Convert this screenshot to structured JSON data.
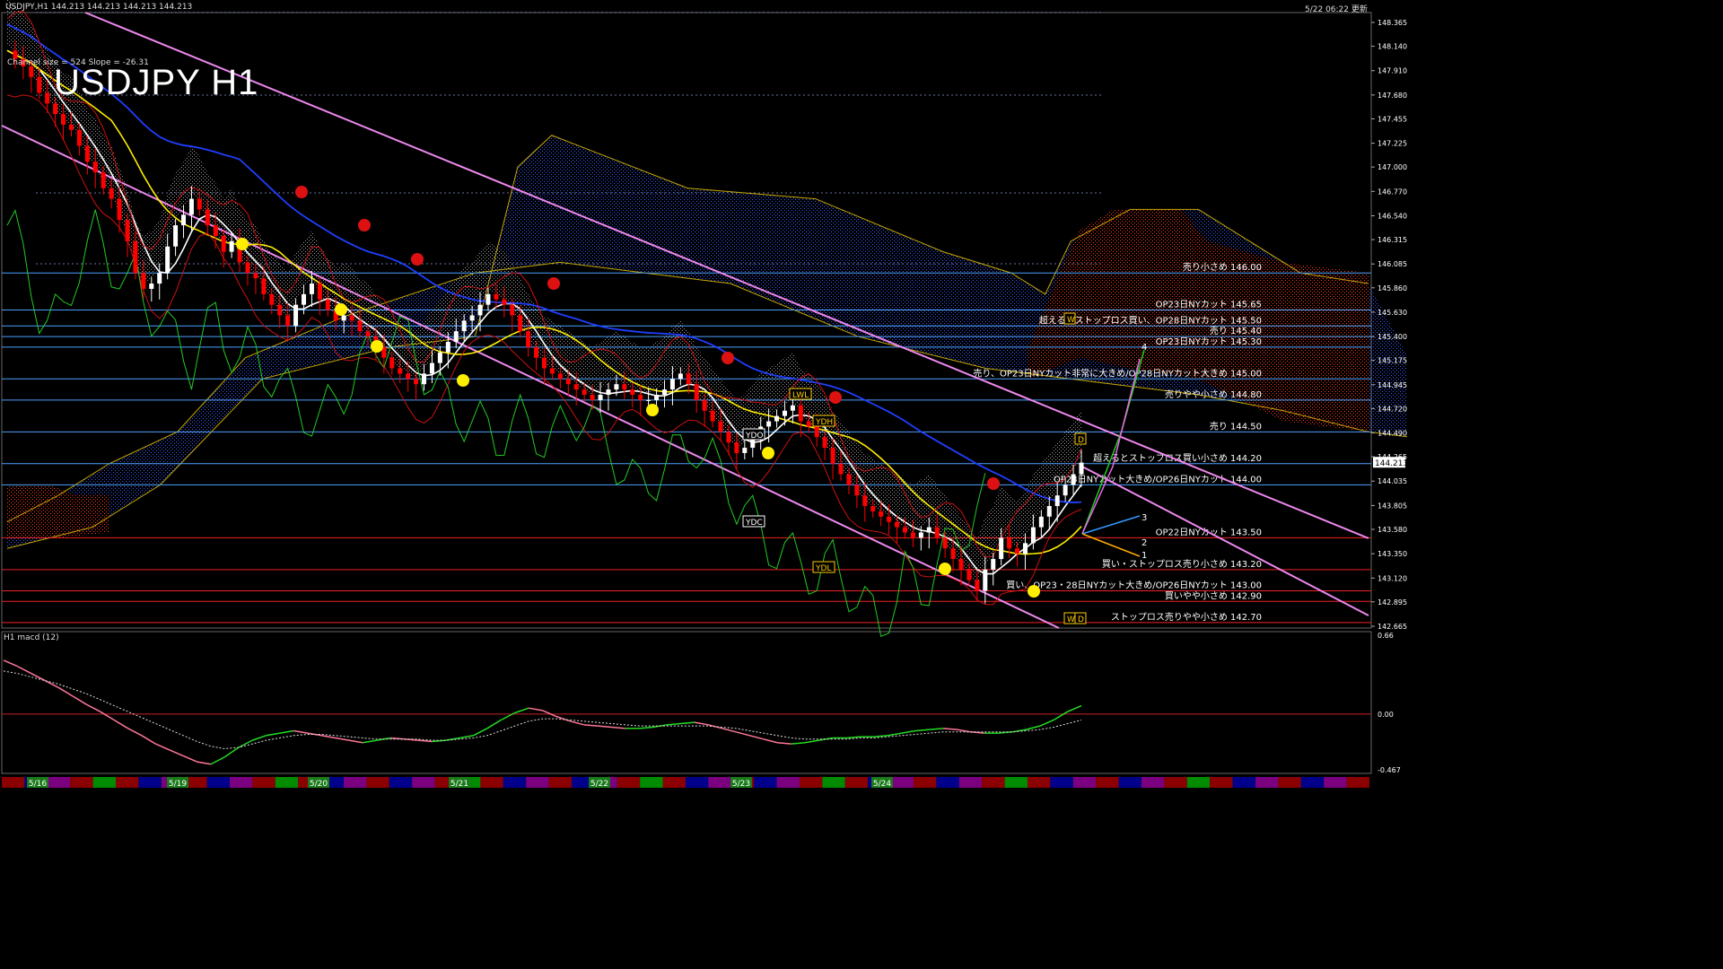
{
  "header": {
    "symbol_info": "USDJPY,H1  144.213 144.213 144.213 144.213",
    "datetime": "5/22 06:22 更新",
    "big_title": "USDJPY H1",
    "channel_info": "Channel size = 524 Slope = -26.31"
  },
  "macd_header": "H1  macd (12)",
  "colors": {
    "background": "#000000",
    "candle_up": "#ffffff",
    "candle_down": "#ff0000",
    "channel": "#ee88ee",
    "cloud_blue": "#2040ff",
    "cloud_red": "#ff3010",
    "ma_yellow": "#ffee00",
    "ma_blue": "#1f3fff",
    "chikou_green": "#22cc22",
    "level_blue": "#4aa0ff",
    "level_red": "#ee2222",
    "macd_green": "#22dd22",
    "macd_pink": "#ff7799"
  },
  "chart_data": [
    {
      "type": "candlestick",
      "title": "USDJPY H1",
      "ylim": [
        142.665,
        148.365
      ],
      "y_ticks": [
        "148.365",
        "148.140",
        "147.910",
        "147.680",
        "147.455",
        "147.225",
        "147.000",
        "146.770",
        "146.540",
        "146.315",
        "146.085",
        "145.860",
        "145.630",
        "145.400",
        "145.175",
        "144.945",
        "144.720",
        "144.490",
        "144.265",
        "144.035",
        "143.805",
        "143.580",
        "143.350",
        "143.120",
        "142.895",
        "142.665"
      ],
      "current_price": "144.213",
      "x_labels": [
        "5/16",
        "5/19",
        "5/20",
        "5/21",
        "5/22",
        "5/23",
        "5/24"
      ],
      "levels": [
        {
          "price": 146.0,
          "label": "売り小さめ 146.00",
          "side": "sell"
        },
        {
          "price": 145.65,
          "label": "OP23日NYカット 145.65",
          "side": "sell"
        },
        {
          "price": 145.5,
          "label": "超えるとストップロス買い、OP28日NYカット 145.50",
          "side": "sell"
        },
        {
          "price": 145.4,
          "label": "売り 145.40",
          "side": "sell"
        },
        {
          "price": 145.3,
          "label": "OP23日NYカット 145.30",
          "side": "sell"
        },
        {
          "price": 145.0,
          "label": "売り、OP23日NYカット非常に大きめ/OP28日NYカット大きめ 145.00",
          "side": "sell"
        },
        {
          "price": 144.8,
          "label": "売りやや小さめ 144.80",
          "side": "sell"
        },
        {
          "price": 144.5,
          "label": "売り 144.50",
          "side": "sell"
        },
        {
          "price": 144.2,
          "label": "超えるとストップロス買い小さめ 144.20",
          "side": "sell"
        },
        {
          "price": 144.0,
          "label": "OP23日NYカット大きめ/OP26日NYカット 144.00",
          "side": "sell"
        },
        {
          "price": 143.5,
          "label": "OP22日NYカット 143.50",
          "side": "buy"
        },
        {
          "price": 143.2,
          "label": "買い・ストップロス売り小さめ 143.20",
          "side": "buy"
        },
        {
          "price": 143.0,
          "label": "買い、OP23・28日NYカット大きめ/OP26日NYカット 143.00",
          "side": "buy"
        },
        {
          "price": 142.9,
          "label": "買いやや小さめ 142.90",
          "side": "buy"
        },
        {
          "price": 142.7,
          "label": "ストップロス売りやや小さめ 142.70",
          "side": "buy"
        }
      ],
      "markers": [
        "YDO",
        "YDC",
        "YDL",
        "YDH",
        "LWL",
        "D",
        "W",
        "D",
        "W"
      ],
      "wave_numbers": [
        "4",
        "3",
        "2",
        "1"
      ],
      "close_series": [
        148.1,
        148.02,
        147.95,
        147.85,
        147.7,
        147.6,
        147.5,
        147.4,
        147.35,
        147.2,
        147.05,
        146.95,
        146.8,
        146.7,
        146.5,
        146.3,
        146.0,
        145.85,
        145.9,
        146.0,
        146.25,
        146.45,
        146.55,
        146.7,
        146.6,
        146.45,
        146.35,
        146.2,
        146.3,
        146.1,
        146.0,
        145.95,
        145.8,
        145.7,
        145.6,
        145.5,
        145.7,
        145.8,
        145.9,
        145.75,
        145.65,
        145.55,
        145.6,
        145.55,
        145.45,
        145.4,
        145.3,
        145.2,
        145.1,
        145.05,
        145.0,
        144.95,
        145.05,
        145.15,
        145.25,
        145.35,
        145.45,
        145.55,
        145.6,
        145.7,
        145.8,
        145.75,
        145.7,
        145.6,
        145.45,
        145.3,
        145.2,
        145.1,
        145.05,
        145.0,
        144.95,
        144.9,
        144.85,
        144.8,
        144.85,
        144.9,
        144.95,
        144.9,
        144.85,
        144.8,
        144.8,
        144.85,
        144.9,
        145.0,
        145.05,
        144.95,
        144.8,
        144.7,
        144.6,
        144.5,
        144.4,
        144.3,
        144.35,
        144.45,
        144.55,
        144.6,
        144.65,
        144.7,
        144.75,
        144.6,
        144.55,
        144.45,
        144.35,
        144.2,
        144.1,
        144.0,
        143.9,
        143.8,
        143.75,
        143.7,
        143.65,
        143.6,
        143.55,
        143.5,
        143.55,
        143.6,
        143.5,
        143.4,
        143.3,
        143.2,
        143.1,
        143.0,
        143.2,
        143.3,
        143.5,
        143.4,
        143.35,
        143.45,
        143.6,
        143.7,
        143.8,
        143.9,
        144.0,
        144.1,
        144.21
      ]
    },
    {
      "type": "line",
      "title": "H1  macd (12)",
      "ylim": [
        -0.467,
        0.66
      ],
      "y_ticks": [
        "0.66",
        "0.00",
        "-0.467"
      ],
      "series": [
        {
          "name": "macd",
          "values": [
            0.45,
            0.4,
            0.34,
            0.28,
            0.22,
            0.15,
            0.08,
            0.02,
            -0.05,
            -0.12,
            -0.18,
            -0.25,
            -0.3,
            -0.35,
            -0.4,
            -0.42,
            -0.36,
            -0.28,
            -0.22,
            -0.18,
            -0.16,
            -0.14,
            -0.16,
            -0.18,
            -0.2,
            -0.22,
            -0.24,
            -0.22,
            -0.2,
            -0.21,
            -0.22,
            -0.23,
            -0.22,
            -0.2,
            -0.18,
            -0.12,
            -0.05,
            0.01,
            0.05,
            0.03,
            -0.02,
            -0.06,
            -0.09,
            -0.1,
            -0.11,
            -0.12,
            -0.12,
            -0.11,
            -0.09,
            -0.08,
            -0.07,
            -0.09,
            -0.12,
            -0.15,
            -0.18,
            -0.21,
            -0.24,
            -0.25,
            -0.24,
            -0.22,
            -0.2,
            -0.2,
            -0.19,
            -0.19,
            -0.18,
            -0.16,
            -0.14,
            -0.13,
            -0.12,
            -0.13,
            -0.15,
            -0.16,
            -0.16,
            -0.15,
            -0.13,
            -0.1,
            -0.05,
            0.02,
            0.07
          ]
        },
        {
          "name": "signal",
          "values": [
            0.36,
            0.34,
            0.31,
            0.28,
            0.25,
            0.21,
            0.17,
            0.12,
            0.07,
            0.02,
            -0.03,
            -0.08,
            -0.13,
            -0.18,
            -0.23,
            -0.27,
            -0.29,
            -0.28,
            -0.25,
            -0.22,
            -0.2,
            -0.18,
            -0.17,
            -0.17,
            -0.18,
            -0.19,
            -0.2,
            -0.21,
            -0.21,
            -0.21,
            -0.21,
            -0.22,
            -0.22,
            -0.21,
            -0.2,
            -0.18,
            -0.14,
            -0.1,
            -0.06,
            -0.04,
            -0.04,
            -0.05,
            -0.06,
            -0.07,
            -0.08,
            -0.09,
            -0.1,
            -0.1,
            -0.1,
            -0.1,
            -0.1,
            -0.1,
            -0.11,
            -0.12,
            -0.14,
            -0.16,
            -0.18,
            -0.2,
            -0.21,
            -0.21,
            -0.21,
            -0.21,
            -0.2,
            -0.2,
            -0.19,
            -0.18,
            -0.17,
            -0.16,
            -0.15,
            -0.15,
            -0.15,
            -0.15,
            -0.15,
            -0.15,
            -0.14,
            -0.13,
            -0.11,
            -0.08,
            -0.05
          ]
        }
      ]
    }
  ]
}
